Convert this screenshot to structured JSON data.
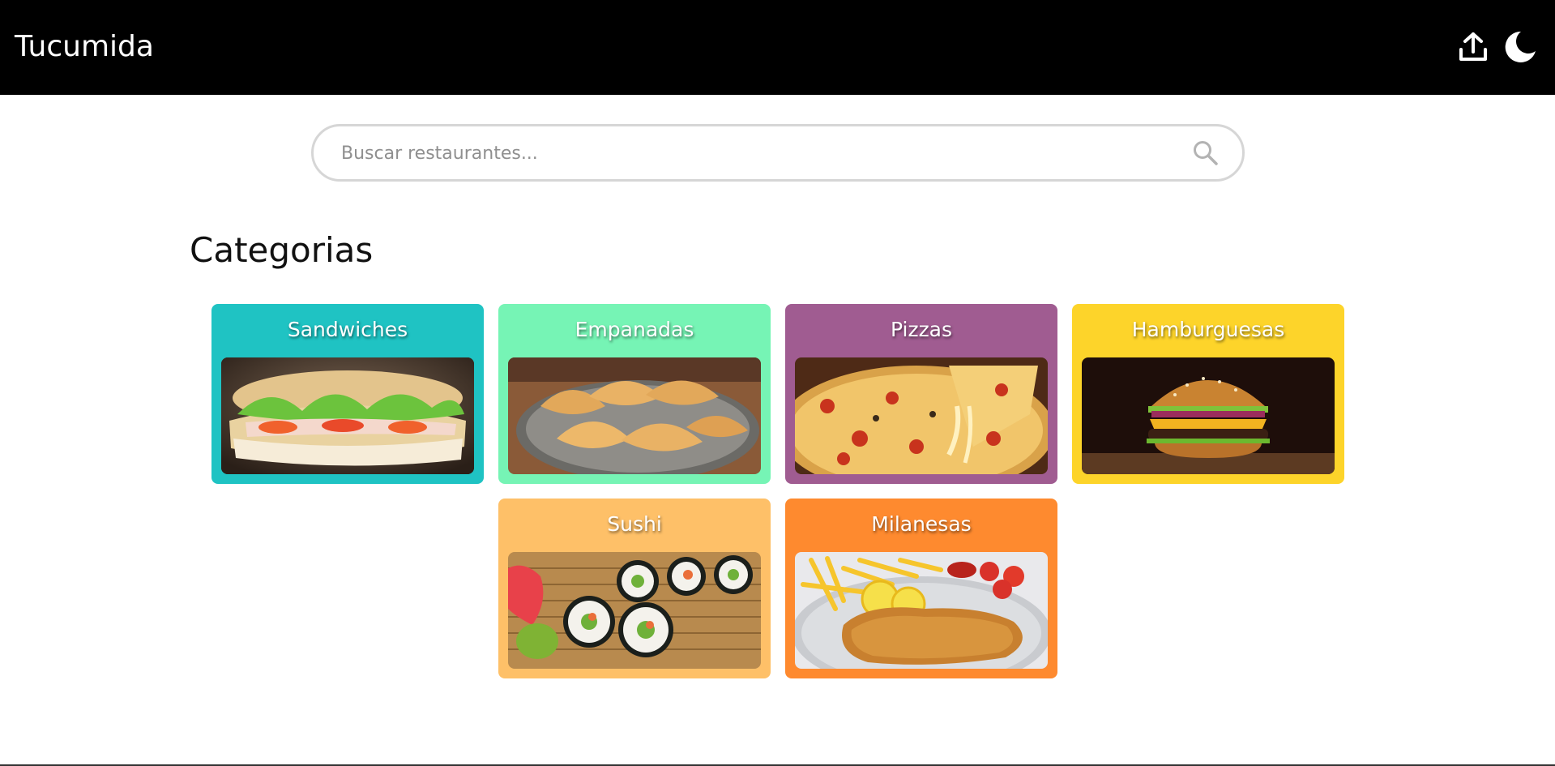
{
  "app": {
    "title": "Tucumida",
    "upload_icon": "upload-icon",
    "theme_icon": "moon-icon"
  },
  "search": {
    "placeholder": "Buscar restaurantes...",
    "value": "",
    "icon": "search-icon"
  },
  "categories": {
    "heading": "Categorias",
    "items": [
      {
        "label": "Sandwiches",
        "color": "#1fc3c3",
        "image": "sandwich-image"
      },
      {
        "label": "Empanadas",
        "color": "#76f4b5",
        "image": "empanadas-image"
      },
      {
        "label": "Pizzas",
        "color": "#a05c91",
        "image": "pizza-image"
      },
      {
        "label": "Hamburguesas",
        "color": "#fdd42a",
        "image": "burger-image"
      },
      {
        "label": "Sushi",
        "color": "#fec068",
        "image": "sushi-image"
      },
      {
        "label": "Milanesas",
        "color": "#fe8a2f",
        "image": "milanesa-image"
      }
    ]
  }
}
